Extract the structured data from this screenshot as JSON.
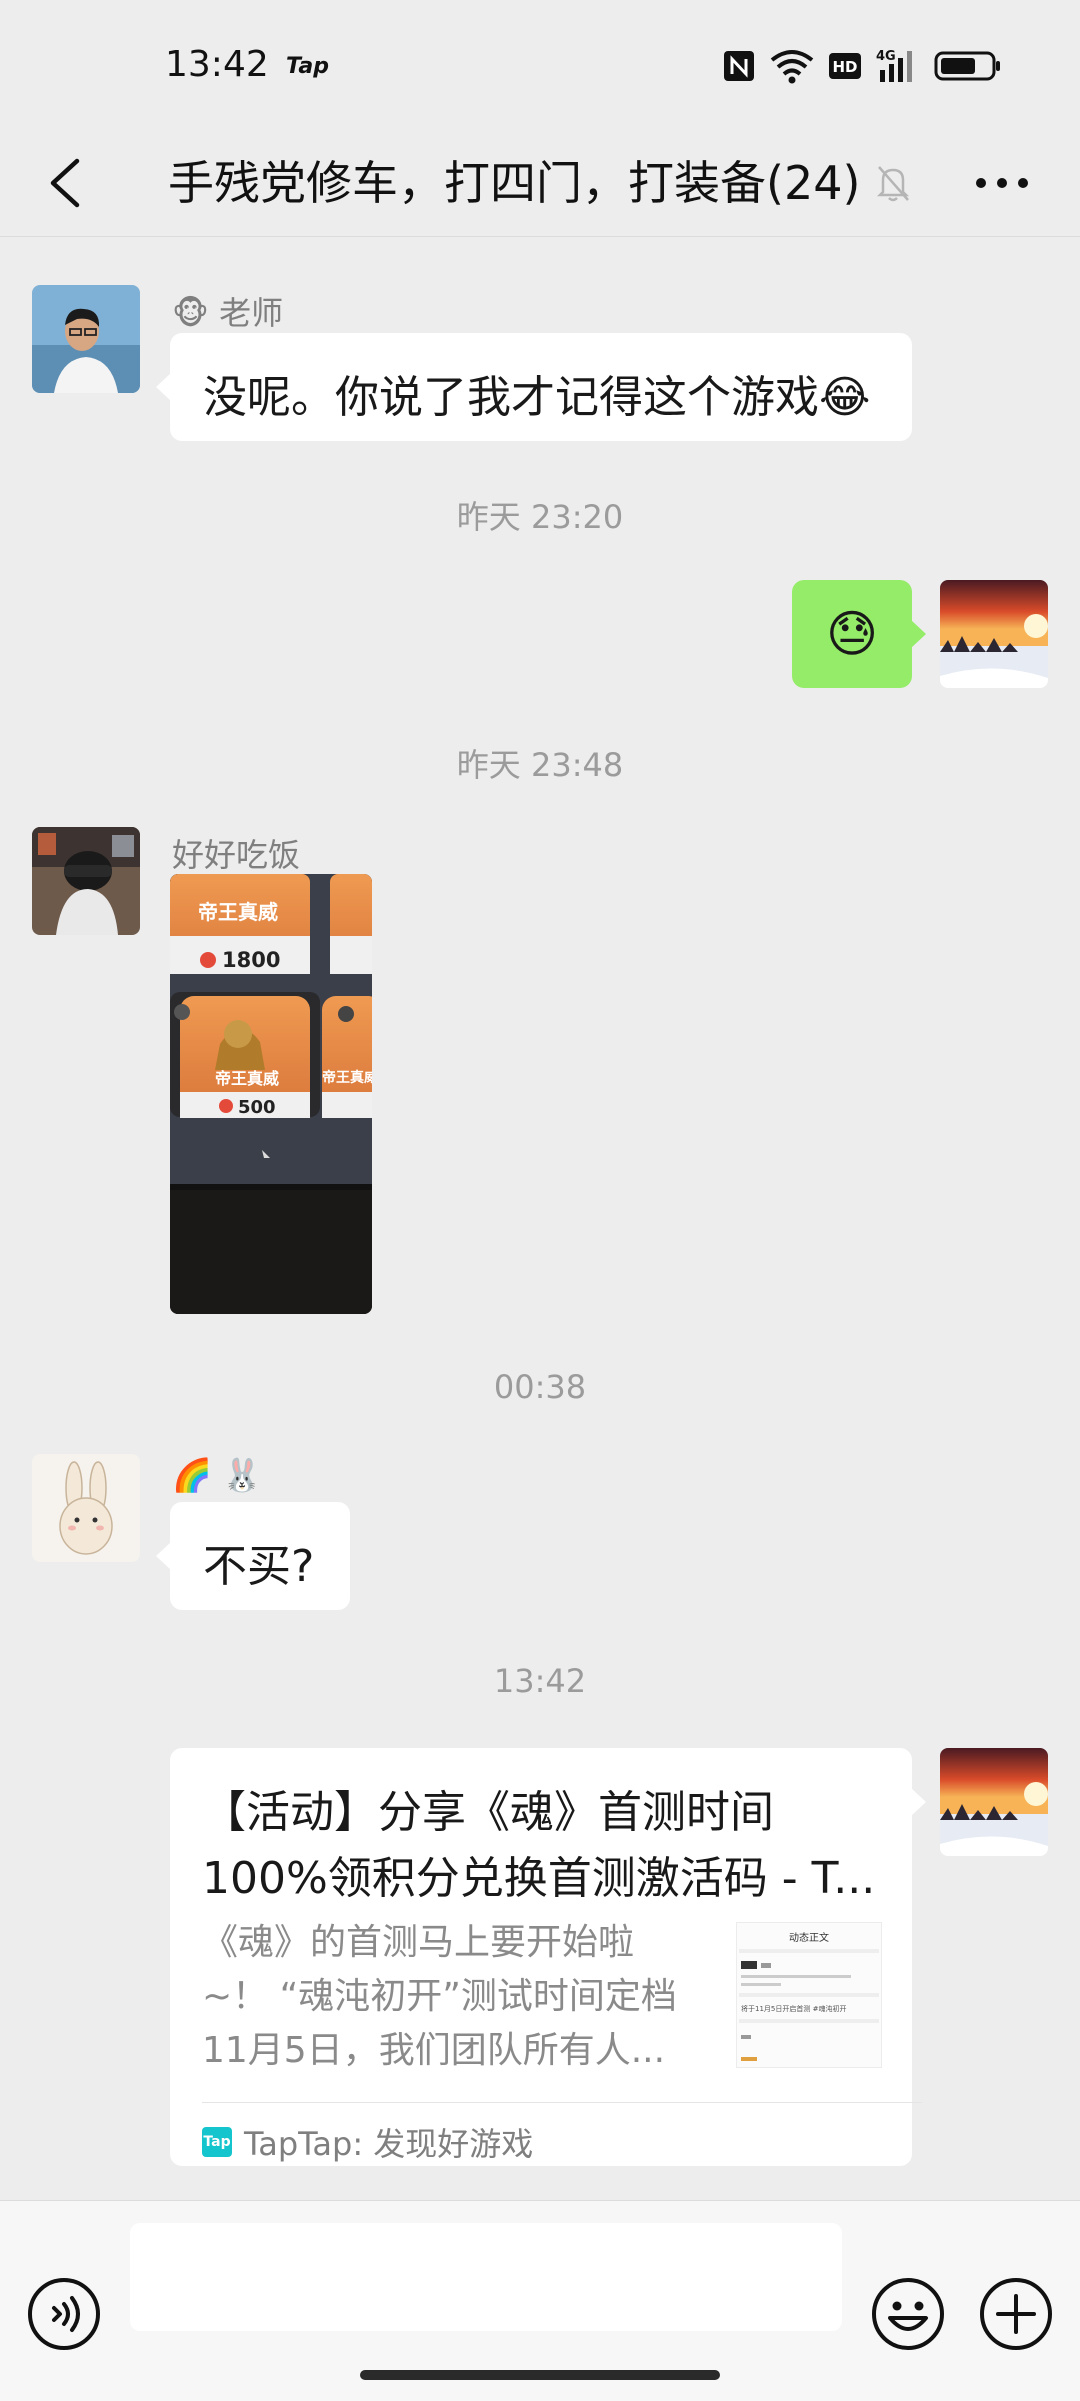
{
  "status_bar": {
    "time": "13:42",
    "app_badge": "Tap",
    "icons": [
      "nfc-icon",
      "wifi-icon",
      "hd-icon",
      "4g-signal-icon",
      "battery-icon"
    ],
    "hd_label": "HD",
    "net_label": "4G"
  },
  "nav": {
    "title": "手残党修车，打四门，打装备(24)",
    "back_icon": "back-arrow-icon",
    "mute_icon": "mute-bell-icon",
    "more_icon": "more-dots-icon"
  },
  "messages": [
    {
      "sender": "🐵 老师",
      "text": "没呢。你说了我才记得这个游戏😂"
    },
    {
      "timestamp": "昨天 23:20"
    },
    {
      "self": true,
      "text": "😓"
    },
    {
      "timestamp": "昨天 23:48"
    },
    {
      "sender": "好好吃饭",
      "image": {
        "items": [
          {
            "name": "帝王真威",
            "price": "1800"
          },
          {
            "name": "帝王真威",
            "price": "500"
          },
          {
            "name": "帝王真威"
          }
        ]
      }
    },
    {
      "timestamp": "00:38"
    },
    {
      "sender": "🌈 🐰",
      "text": "不买?"
    },
    {
      "timestamp": "13:42"
    },
    {
      "self": true,
      "link_card": {
        "title_line1": "【活动】分享《魂》首测时间",
        "title_line2": "100%领积分兑换首测激活码 - T...",
        "desc_line1": "《魂》的首测马上要开始啦",
        "desc_line2": "~！ “魂沌初开”测试时间定档",
        "desc_line3": "11月5日，我们团队所有人...",
        "source": "TapTap: 发现好游戏",
        "thumb_heading": "动态正文",
        "thumb_line": "将于11月5日开启首测 #魂沌初开"
      }
    }
  ],
  "input_bar": {
    "placeholder": "",
    "voice_icon": "voice-icon",
    "emoji_icon": "emoji-icon",
    "plus_icon": "plus-icon"
  },
  "colors": {
    "background": "#ededed",
    "self_bubble": "#95ec69",
    "other_bubble": "#ffffff",
    "timestamp": "#9b9b9b",
    "taptap_brand": "#15c5ce"
  }
}
